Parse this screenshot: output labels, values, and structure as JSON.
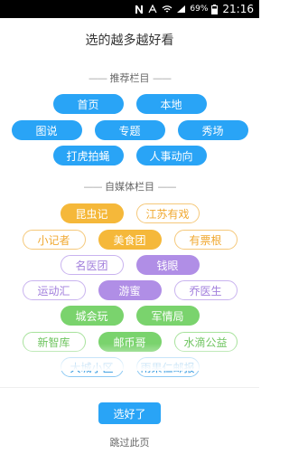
{
  "status_bar": {
    "battery_percent": "69%",
    "time": "21:16"
  },
  "title": "选的越多越好看",
  "recommended": {
    "header": "推荐栏目",
    "rows": [
      [
        "首页",
        "本地"
      ],
      [
        "图说",
        "专题",
        "秀场"
      ],
      [
        "打虎拍蝇",
        "人事动向"
      ]
    ]
  },
  "media": {
    "header": "自媒体栏目",
    "rows": [
      [
        "昆虫记",
        "江苏有戏"
      ],
      [
        "小记者",
        "美食团",
        "有票根"
      ],
      [
        "名医团",
        "钱眼"
      ],
      [
        "运动汇",
        "游蜜",
        "乔医生"
      ],
      [
        "城会玩",
        "军情局"
      ],
      [
        "新智库",
        "邮币哥",
        "水滴公益"
      ],
      [
        "大城小区",
        "雨果仁邮报"
      ]
    ]
  },
  "buttons": {
    "confirm": "选好了",
    "skip": "跳过此页"
  },
  "colors": {
    "accent_blue": "#29a4f6",
    "orange": "#f5b83a",
    "purple": "#b08ee6",
    "green": "#7ad36d"
  }
}
